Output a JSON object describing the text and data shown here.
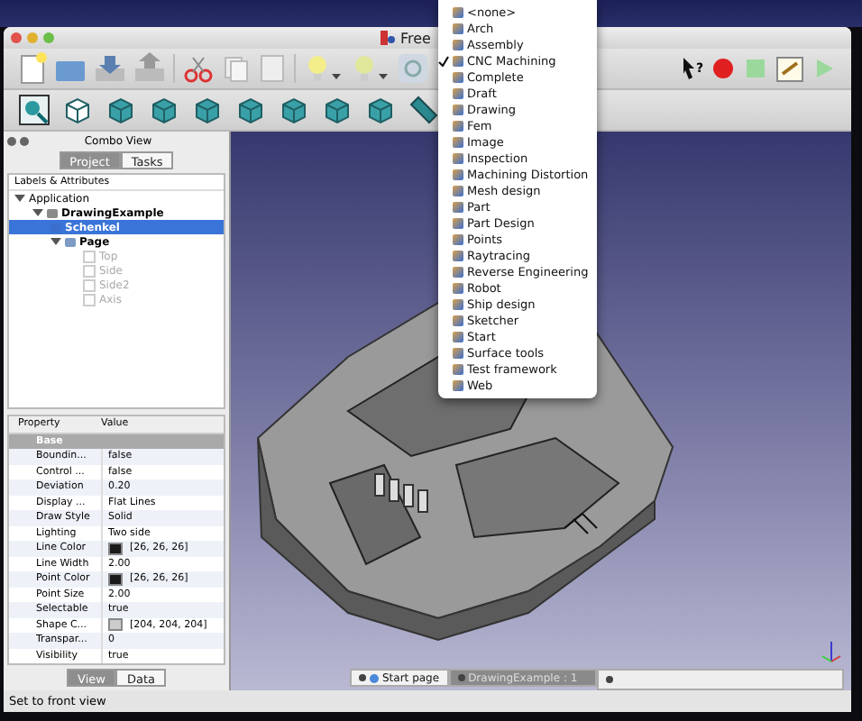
{
  "window": {
    "title": "Free"
  },
  "toolbar": {
    "whats_this_glyph": "?"
  },
  "combo_view": {
    "title": "Combo View",
    "tabs": [
      {
        "label": "Project",
        "selected": true
      },
      {
        "label": "Tasks",
        "selected": false
      }
    ],
    "tree_header": "Labels & Attributes",
    "tree": [
      {
        "label": "Application",
        "selected": false,
        "disabled": false,
        "expanded": true,
        "children": [
          {
            "label": "DrawingExample",
            "kind": "document",
            "selected": false,
            "disabled": false,
            "expanded": true,
            "children": [
              {
                "label": "Schenkel",
                "kind": "part",
                "selected": true,
                "disabled": false
              },
              {
                "label": "Page",
                "kind": "folder",
                "selected": false,
                "disabled": false,
                "expanded": true,
                "children": [
                  {
                    "label": "Top",
                    "kind": "view",
                    "selected": false,
                    "disabled": true
                  },
                  {
                    "label": "Side",
                    "kind": "view",
                    "selected": false,
                    "disabled": true
                  },
                  {
                    "label": "Side2",
                    "kind": "view",
                    "selected": false,
                    "disabled": true
                  },
                  {
                    "label": "Axis",
                    "kind": "view",
                    "selected": false,
                    "disabled": true
                  }
                ]
              }
            ]
          }
        ]
      }
    ]
  },
  "properties": {
    "columns": [
      "Property",
      "Value"
    ],
    "rows": [
      {
        "kind": "group",
        "name": "Base"
      },
      {
        "kind": "text",
        "name": "Boundin...",
        "value": "false"
      },
      {
        "kind": "text",
        "name": "Control ...",
        "value": "false"
      },
      {
        "kind": "text",
        "name": "Deviation",
        "value": "0.20"
      },
      {
        "kind": "text",
        "name": "Display ...",
        "value": "Flat Lines"
      },
      {
        "kind": "text",
        "name": "Draw Style",
        "value": "Solid"
      },
      {
        "kind": "text",
        "name": "Lighting",
        "value": "Two side"
      },
      {
        "kind": "color",
        "name": "Line Color",
        "value": "[26, 26, 26]",
        "color": "#1a1a1a"
      },
      {
        "kind": "text",
        "name": "Line Width",
        "value": "2.00"
      },
      {
        "kind": "color",
        "name": "Point Color",
        "value": "[26, 26, 26]",
        "color": "#1a1a1a"
      },
      {
        "kind": "text",
        "name": "Point Size",
        "value": "2.00"
      },
      {
        "kind": "text",
        "name": "Selectable",
        "value": "true"
      },
      {
        "kind": "color",
        "name": "Shape C...",
        "value": "[204, 204, 204]",
        "color": "#cccccc"
      },
      {
        "kind": "text",
        "name": "Transpar...",
        "value": "0"
      },
      {
        "kind": "text",
        "name": "Visibility",
        "value": "true"
      }
    ],
    "tabs": [
      {
        "label": "View",
        "selected": true
      },
      {
        "label": "Data",
        "selected": false
      }
    ]
  },
  "document_tabs": [
    {
      "label": "Start page",
      "kind": "web",
      "selected": false
    },
    {
      "label": "DrawingExample : 1",
      "kind": "document",
      "selected": true
    }
  ],
  "workbench_menu": [
    {
      "label": "<none>",
      "checked": false
    },
    {
      "label": "Arch",
      "checked": false
    },
    {
      "label": "Assembly",
      "checked": false
    },
    {
      "label": "CNC Machining",
      "checked": true
    },
    {
      "label": "Complete",
      "checked": false
    },
    {
      "label": "Draft",
      "checked": false
    },
    {
      "label": "Drawing",
      "checked": false
    },
    {
      "label": "Fem",
      "checked": false
    },
    {
      "label": "Image",
      "checked": false
    },
    {
      "label": "Inspection",
      "checked": false
    },
    {
      "label": "Machining Distortion",
      "checked": false
    },
    {
      "label": "Mesh design",
      "checked": false
    },
    {
      "label": "Part",
      "checked": false
    },
    {
      "label": "Part Design",
      "checked": false
    },
    {
      "label": "Points",
      "checked": false
    },
    {
      "label": "Raytracing",
      "checked": false
    },
    {
      "label": "Reverse Engineering",
      "checked": false
    },
    {
      "label": "Robot",
      "checked": false
    },
    {
      "label": "Ship design",
      "checked": false
    },
    {
      "label": "Sketcher",
      "checked": false
    },
    {
      "label": "Start",
      "checked": false
    },
    {
      "label": "Surface tools",
      "checked": false
    },
    {
      "label": "Test framework",
      "checked": false
    },
    {
      "label": "Web",
      "checked": false
    }
  ],
  "status_bar": "Set to front view"
}
